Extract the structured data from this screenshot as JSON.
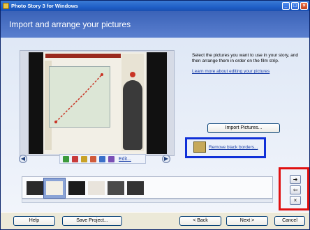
{
  "window": {
    "title": "Photo Story 3 for Windows"
  },
  "window_controls": {
    "minimize": "_",
    "maximize": "□",
    "close": "×"
  },
  "header": {
    "title": "Import and arrange your pictures"
  },
  "instructions": {
    "text": "Select the pictures you want to use in your story, and then arrange them in order on the film strip.",
    "learn_more": "Learn more about editing your pictures"
  },
  "preview": {
    "prev_arrow": "◀",
    "next_arrow": "▶",
    "edit_label": "Edit..."
  },
  "import_button": "Import Pictures...",
  "remove_borders_link": "Remove black borders...",
  "filmstrip_controls": {
    "move_right": "➜",
    "move_left": "⇦",
    "delete": "×"
  },
  "footer": {
    "help": "Help",
    "save_project": "Save Project...",
    "back": "< Back",
    "next": "Next >",
    "cancel": "Cancel"
  },
  "colors": {
    "accent": "#1f5fc7",
    "link": "#1a3fa8",
    "highlight_blue": "#1030d8",
    "highlight_red": "#e01010"
  },
  "icons": [
    "rotate-left-icon",
    "rotate-right-icon",
    "color-icon",
    "red-eye-icon",
    "auto-fix-icon",
    "edit-icon"
  ]
}
